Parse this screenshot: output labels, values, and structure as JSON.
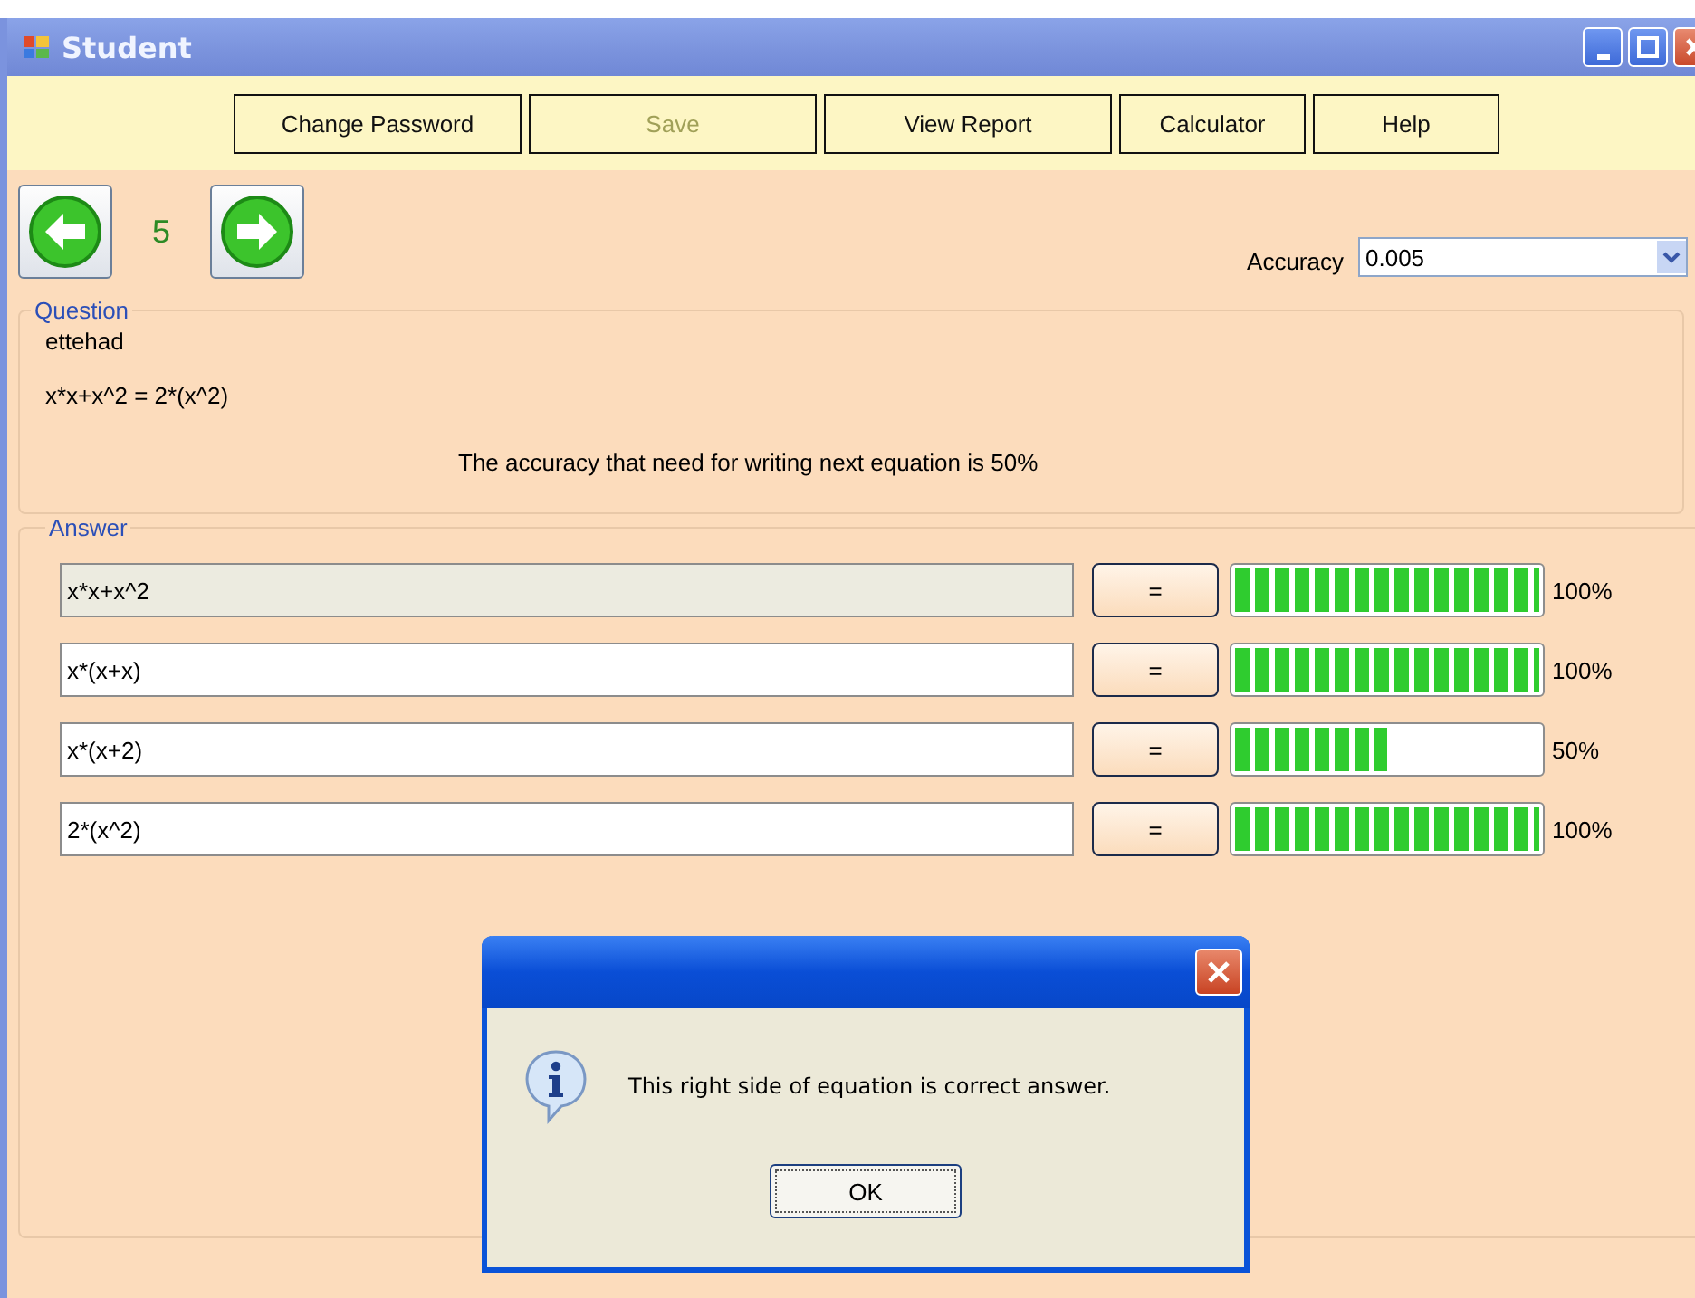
{
  "window": {
    "title": "Student"
  },
  "toolbar": [
    {
      "label": "Change Password",
      "disabled": false
    },
    {
      "label": "Save",
      "disabled": true
    },
    {
      "label": "View Report",
      "disabled": false
    },
    {
      "label": "Calculator",
      "disabled": false
    },
    {
      "label": "Help",
      "disabled": false
    }
  ],
  "navigation": {
    "number": "5"
  },
  "accuracy": {
    "label": "Accuracy",
    "value": "0.005"
  },
  "question": {
    "legend": "Question",
    "name": "ettehad",
    "equation": "x*x+x^2 = 2*(x^2)",
    "requirement": "The accuracy that need for writing next equation is 50%"
  },
  "answer": {
    "legend": "Answer",
    "rows": [
      {
        "value": "x*x+x^2",
        "disabled": true,
        "button": "=",
        "level": 1,
        "reading": "100%"
      },
      {
        "value": "x*(x+x)",
        "disabled": false,
        "button": "=",
        "level": 1,
        "reading": "100%"
      },
      {
        "value": "x*(x+2)",
        "disabled": false,
        "button": "=",
        "level": 0.5,
        "reading": "50%"
      },
      {
        "value": "2*(x^2)",
        "disabled": false,
        "button": "=",
        "level": 1,
        "reading": "100%"
      }
    ]
  },
  "dialog": {
    "message": "This right side of equation is correct answer.",
    "button": "OK"
  }
}
